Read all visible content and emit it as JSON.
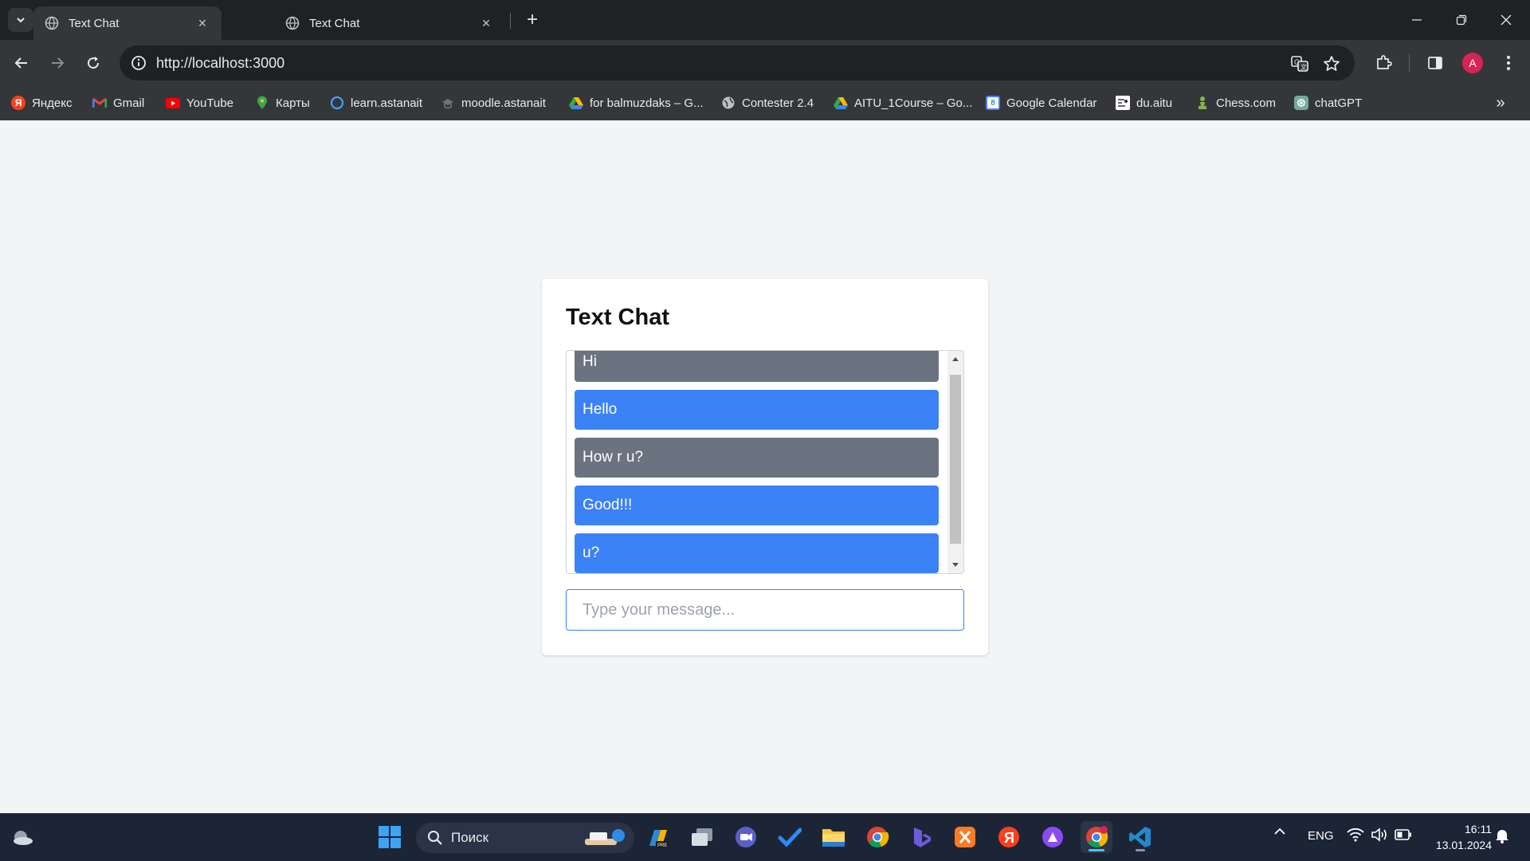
{
  "browser": {
    "tabs": [
      {
        "title": "Text Chat",
        "active": true
      },
      {
        "title": "Text Chat",
        "active": false
      }
    ],
    "url": "http://localhost:3000",
    "profile_initial": "A",
    "bookmarks": [
      {
        "label": "Яндекс",
        "icon": "yandex-icon"
      },
      {
        "label": "Gmail",
        "icon": "gmail-icon"
      },
      {
        "label": "YouTube",
        "icon": "youtube-icon"
      },
      {
        "label": "Карты",
        "icon": "maps-pin-icon"
      },
      {
        "label": "learn.astanait",
        "icon": "circle-icon"
      },
      {
        "label": "moodle.astanait",
        "icon": "moodle-icon"
      },
      {
        "label": "for balmuzdaks – G...",
        "icon": "google-drive-icon"
      },
      {
        "label": "Contester 2.4",
        "icon": "globe-icon"
      },
      {
        "label": "AITU_1Course – Go...",
        "icon": "google-drive-icon"
      },
      {
        "label": "Google Calendar",
        "icon": "calendar-icon"
      },
      {
        "label": "du.aitu",
        "icon": "du-icon"
      },
      {
        "label": "Chess.com",
        "icon": "chess-pawn-icon"
      },
      {
        "label": "chatGPT",
        "icon": "chatgpt-icon"
      }
    ]
  },
  "chat": {
    "title": "Text Chat",
    "messages": [
      {
        "text": "Hi",
        "type": "sent"
      },
      {
        "text": "Hello",
        "type": "received"
      },
      {
        "text": "How r u?",
        "type": "sent"
      },
      {
        "text": "Good!!!",
        "type": "received"
      },
      {
        "text": "u?",
        "type": "received"
      }
    ],
    "input_placeholder": "Type your message...",
    "input_value": ""
  },
  "colors": {
    "sent_bubble": "#6b7280",
    "received_bubble": "#3b82f6",
    "page_background": "#f3f4f6",
    "input_border": "#3b82f6"
  },
  "taskbar": {
    "search_label": "Поиск",
    "language": "ENG",
    "time": "16:11",
    "date": "13.01.2024"
  }
}
